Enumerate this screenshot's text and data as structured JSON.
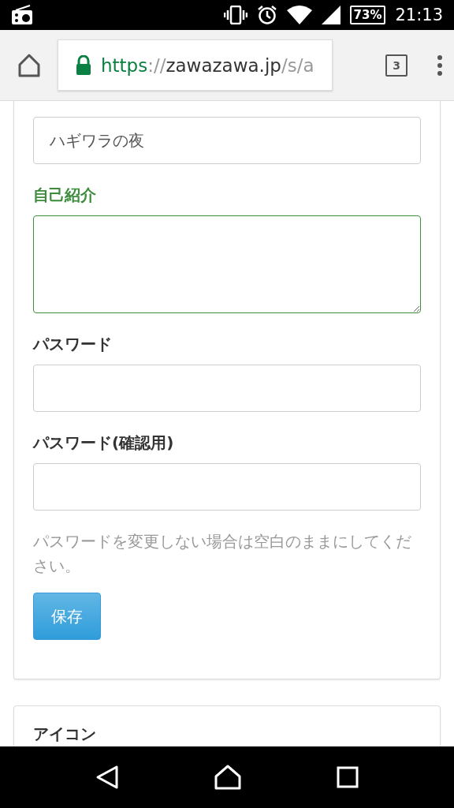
{
  "status_bar": {
    "battery": "73%",
    "time": "21:13"
  },
  "toolbar": {
    "url_scheme": "https",
    "url_separator": "://",
    "url_host": "zawazawa.jp",
    "url_path": "/s/a",
    "tab_count": "3"
  },
  "form": {
    "fields": [
      {
        "kind": "input",
        "value": "ハギワラの夜",
        "focused": false
      },
      {
        "kind": "textarea",
        "label": "自己紹介",
        "focused": true
      },
      {
        "kind": "input",
        "label": "パスワード",
        "focused": false
      },
      {
        "kind": "input",
        "label": "パスワード(確認用)",
        "focused": false
      }
    ],
    "help": "パスワードを変更しない場合は空白のままにしてください。",
    "save_button": "保存"
  },
  "icon_card": {
    "title": "アイコン"
  }
}
